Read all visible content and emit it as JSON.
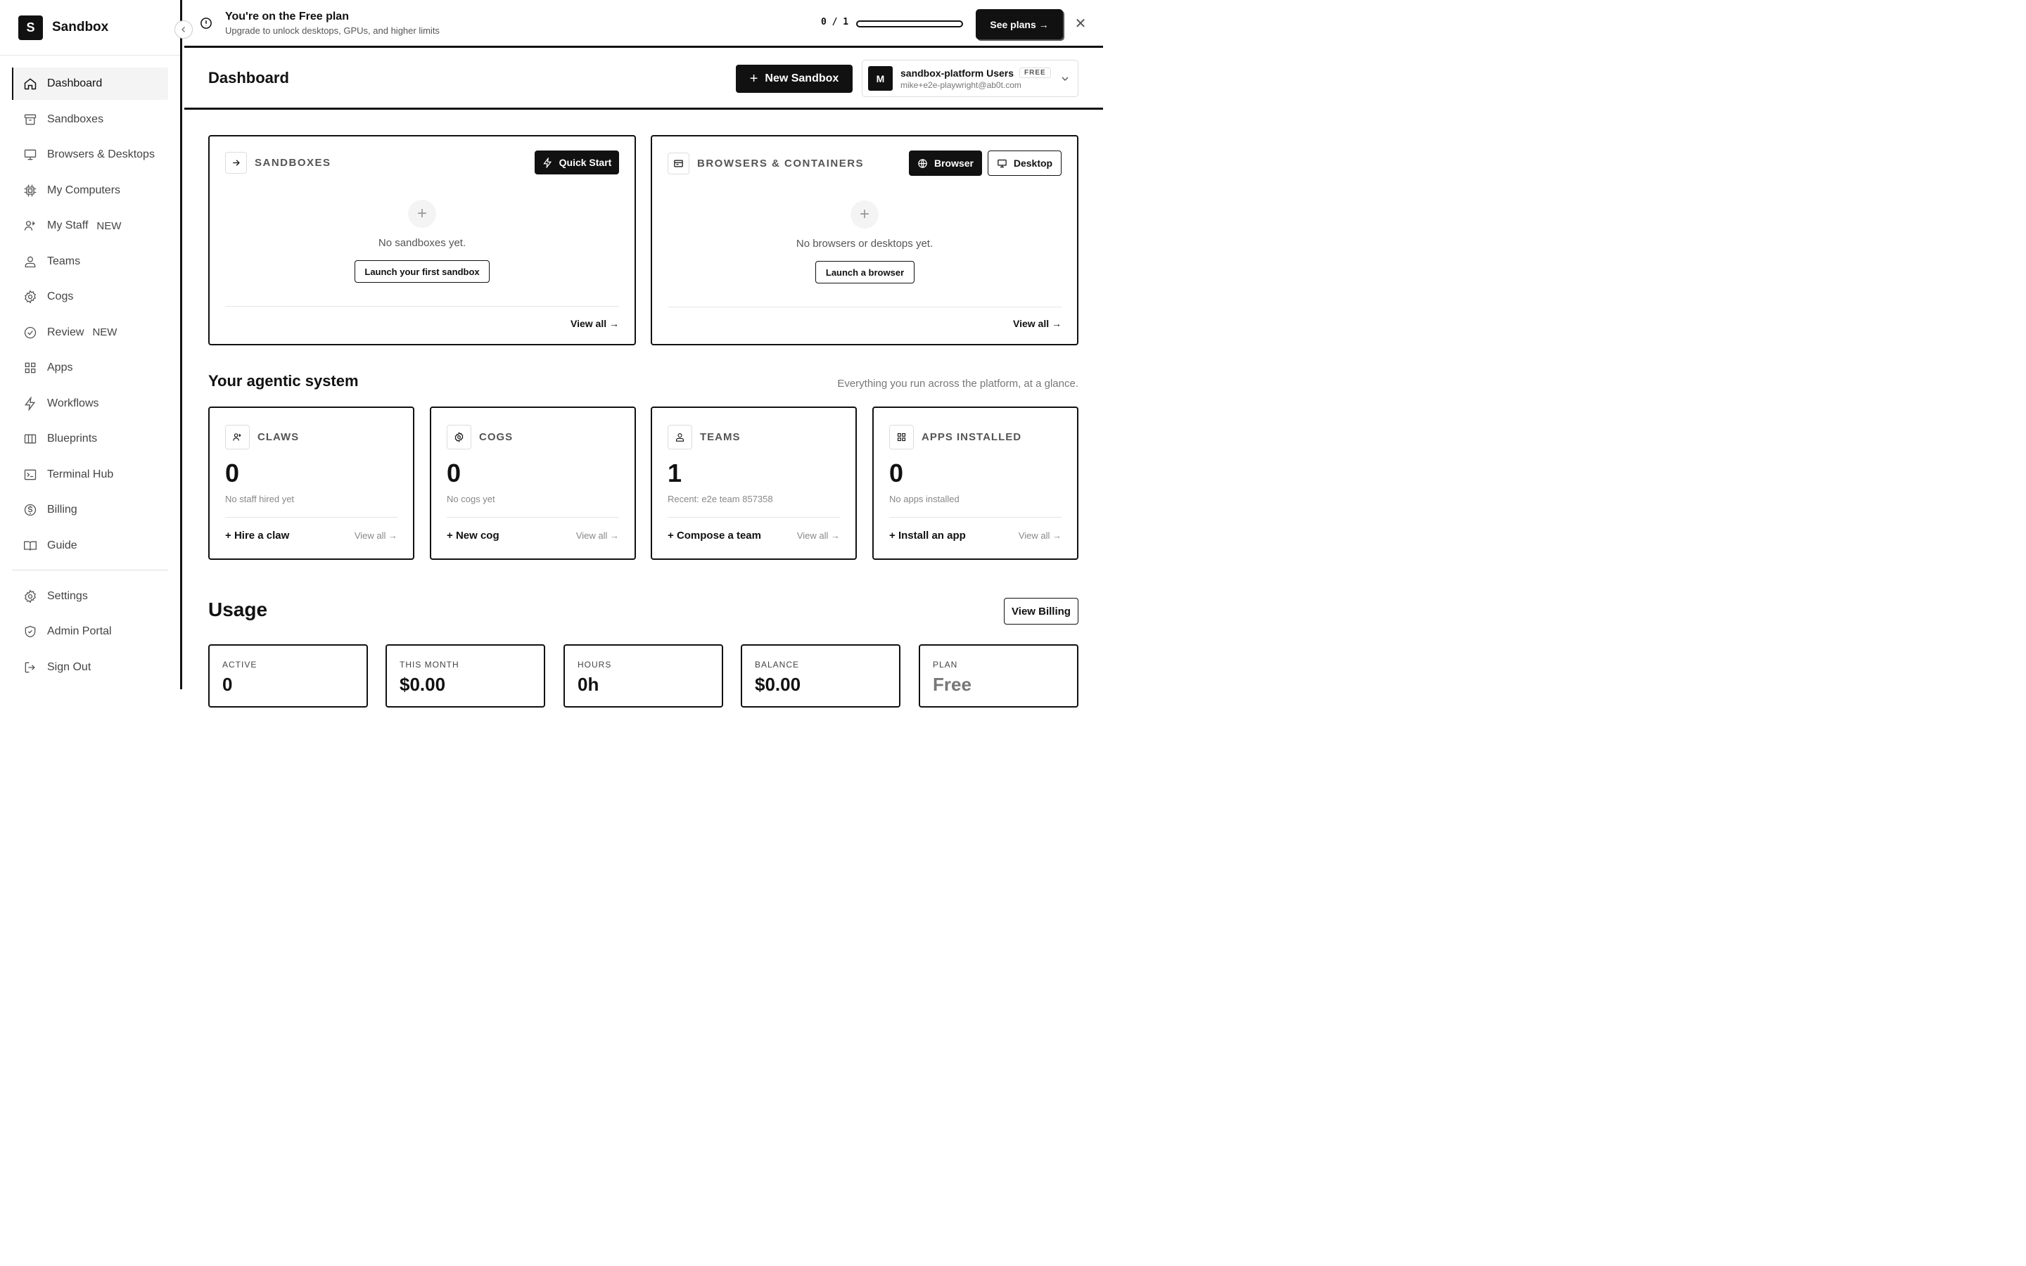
{
  "brand": {
    "logo_letter": "S",
    "name": "Sandbox"
  },
  "sidebar": {
    "items": [
      {
        "label": "Dashboard",
        "icon": "home-icon",
        "active": true,
        "tag": ""
      },
      {
        "label": "Sandboxes",
        "icon": "archive-icon",
        "tag": ""
      },
      {
        "label": "Browsers & Desktops",
        "icon": "monitor-icon",
        "tag": ""
      },
      {
        "label": "My Computers",
        "icon": "cpu-icon",
        "tag": ""
      },
      {
        "label": "My Staff",
        "icon": "staff-icon",
        "tag": "NEW"
      },
      {
        "label": "Teams",
        "icon": "users-icon",
        "tag": ""
      },
      {
        "label": "Cogs",
        "icon": "gear-icon",
        "tag": ""
      },
      {
        "label": "Review",
        "icon": "check-circle-icon",
        "tag": "NEW"
      },
      {
        "label": "Apps",
        "icon": "grid-icon",
        "tag": ""
      },
      {
        "label": "Workflows",
        "icon": "bolt-icon",
        "tag": ""
      },
      {
        "label": "Blueprints",
        "icon": "columns-icon",
        "tag": ""
      },
      {
        "label": "Terminal Hub",
        "icon": "terminal-icon",
        "tag": ""
      },
      {
        "label": "Billing",
        "icon": "dollar-icon",
        "tag": ""
      },
      {
        "label": "Guide",
        "icon": "book-icon",
        "tag": ""
      }
    ],
    "bottom_items": [
      {
        "label": "Settings",
        "icon": "gear-icon"
      },
      {
        "label": "Admin Portal",
        "icon": "shield-icon"
      },
      {
        "label": "Sign Out",
        "icon": "logout-icon"
      }
    ]
  },
  "banner": {
    "title": "You're on the Free plan",
    "subtitle": "Upgrade to unlock desktops, GPUs, and higher limits",
    "usage_text": "0 / 1",
    "usage_fraction": 0,
    "cta": "See plans →",
    "close": "✕"
  },
  "header": {
    "title": "Dashboard",
    "new_sandbox": "New Sandbox",
    "account": {
      "avatar": "M",
      "name": "sandbox-platform Users",
      "plan_tag": "FREE",
      "email": "mike+e2e-playwright@ab0t.com"
    }
  },
  "sandboxes_card": {
    "title": "SANDBOXES",
    "quick_start": "Quick Start",
    "empty_text": "No sandboxes yet.",
    "empty_button": "Launch your first sandbox",
    "view_all": "View all →"
  },
  "browsers_card": {
    "title": "BROWSERS & CONTAINERS",
    "browser_btn": "Browser",
    "desktop_btn": "Desktop",
    "empty_text": "No browsers or desktops yet.",
    "empty_button": "Launch a browser",
    "view_all": "View all →"
  },
  "agentic": {
    "title": "Your agentic system",
    "subtitle": "Everything you run across the platform, at a glance.",
    "cards": [
      {
        "title": "CLAWS",
        "icon": "staff-icon",
        "value": "0",
        "sub": "No staff hired yet",
        "action": "Hire a claw",
        "view": "View all →"
      },
      {
        "title": "COGS",
        "icon": "gear-icon",
        "value": "0",
        "sub": "No cogs yet",
        "action": "New cog",
        "view": "View all →"
      },
      {
        "title": "TEAMS",
        "icon": "users-icon",
        "value": "1",
        "sub": "Recent: e2e team 857358",
        "action": "Compose a team",
        "view": "View all →"
      },
      {
        "title": "APPS INSTALLED",
        "icon": "grid-icon",
        "value": "0",
        "sub": "No apps installed",
        "action": "Install an app",
        "view": "View all →"
      }
    ]
  },
  "usage": {
    "title": "Usage",
    "view_billing": "View Billing",
    "cards": [
      {
        "label": "ACTIVE",
        "value": "0"
      },
      {
        "label": "THIS MONTH",
        "value": "$0.00"
      },
      {
        "label": "HOURS",
        "value": "0h"
      },
      {
        "label": "BALANCE",
        "value": "$0.00"
      },
      {
        "label": "PLAN",
        "value": "Free"
      }
    ]
  }
}
